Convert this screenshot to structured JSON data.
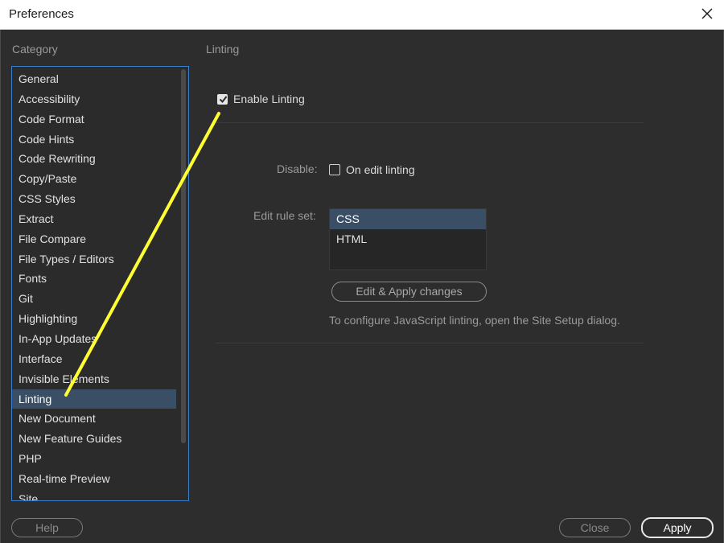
{
  "window": {
    "title": "Preferences"
  },
  "category": {
    "heading": "Category",
    "items": [
      {
        "label": "General"
      },
      {
        "label": "Accessibility"
      },
      {
        "label": "Code Format"
      },
      {
        "label": "Code Hints"
      },
      {
        "label": "Code Rewriting"
      },
      {
        "label": "Copy/Paste"
      },
      {
        "label": "CSS Styles"
      },
      {
        "label": "Extract"
      },
      {
        "label": "File Compare"
      },
      {
        "label": "File Types / Editors"
      },
      {
        "label": "Fonts"
      },
      {
        "label": "Git"
      },
      {
        "label": "Highlighting"
      },
      {
        "label": "In-App Updates"
      },
      {
        "label": "Interface"
      },
      {
        "label": "Invisible Elements"
      },
      {
        "label": "Linting"
      },
      {
        "label": "New Document"
      },
      {
        "label": "New Feature Guides"
      },
      {
        "label": "PHP"
      },
      {
        "label": "Real-time Preview"
      },
      {
        "label": "Site"
      }
    ],
    "selected": "Linting"
  },
  "panel": {
    "heading": "Linting",
    "enable_linting": {
      "label": "Enable Linting",
      "checked": true
    },
    "disable": {
      "label": "Disable:",
      "on_edit": {
        "label": "On edit linting",
        "checked": false
      }
    },
    "ruleset": {
      "label": "Edit rule set:",
      "items": [
        {
          "label": "CSS"
        },
        {
          "label": "HTML"
        }
      ],
      "selected": "CSS"
    },
    "edit_apply_button": "Edit  & Apply changes",
    "info": "To configure JavaScript linting, open the Site Setup dialog."
  },
  "footer": {
    "help": "Help",
    "close": "Close",
    "apply": "Apply"
  },
  "colors": {
    "background": "#2d2d2d",
    "selection": "#3a4e66",
    "list_border": "#3b7fcc",
    "annotation_arrow": "#ffff33"
  },
  "icons": {
    "close": "close-icon",
    "check": "checkmark-icon"
  }
}
